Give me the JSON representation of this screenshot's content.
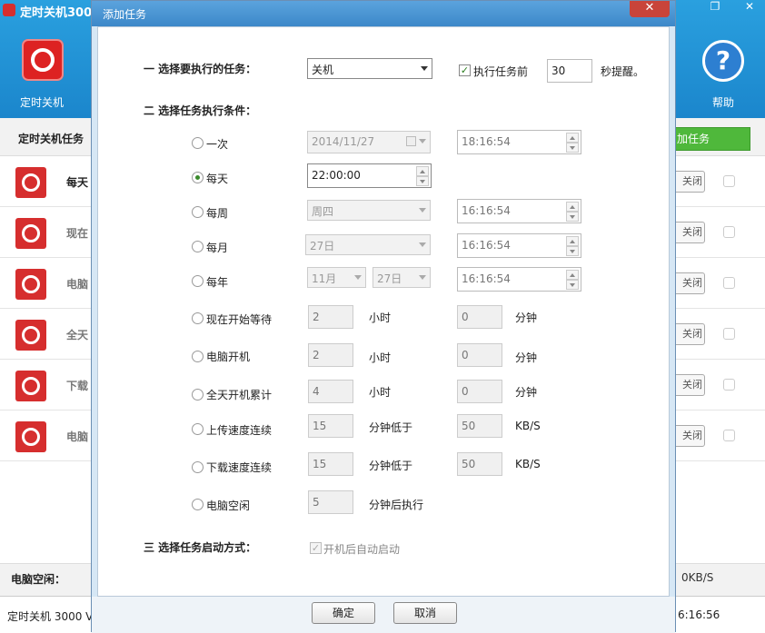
{
  "background": {
    "title": "定时关机3000",
    "logo_label": "定时关机",
    "help_label": "帮助",
    "toolbar_label": "定时关机任务",
    "add_button": "加任务",
    "rows": [
      {
        "text": "每天",
        "button": "关闭"
      },
      {
        "text": "现在",
        "button": "关闭"
      },
      {
        "text": "电脑",
        "button": "关闭"
      },
      {
        "text": "全天",
        "button": "关闭"
      },
      {
        "text": "下载",
        "button": "关闭"
      },
      {
        "text": "电脑",
        "button": "关闭"
      }
    ],
    "idle_label": "电脑空闲：",
    "speed": "0KB/S",
    "version": "定时关机 3000 V",
    "time": "6:16:56",
    "restore_icon": "❐",
    "close_icon": "✕"
  },
  "dialog": {
    "title": "添加任务",
    "close_icon": "✕",
    "section1": "一 选择要执行的任务：",
    "task_select": "关机",
    "remind_checked": true,
    "remind_label": "执行任务前",
    "remind_value": "30",
    "remind_unit": "秒提醒。",
    "section2": "二 选择任务执行条件：",
    "conditions": {
      "once": {
        "label": "一次",
        "date": "2014/11/27",
        "time": "18:16:54"
      },
      "daily": {
        "label": "每天",
        "time": "22:00:00"
      },
      "weekly": {
        "label": "每周",
        "weekday": "周四",
        "time": "16:16:54"
      },
      "monthly": {
        "label": "每月",
        "day": "27日",
        "time": "16:16:54"
      },
      "yearly": {
        "label": "每年",
        "month": "11月",
        "day": "27日",
        "time": "16:16:54"
      },
      "wait": {
        "label": "现在开始等待",
        "hours": "2",
        "unit1": "小时",
        "minutes": "0",
        "unit2": "分钟"
      },
      "boot": {
        "label": "电脑开机",
        "hours": "2",
        "unit1": "小时",
        "minutes": "0",
        "unit2": "分钟"
      },
      "uptime": {
        "label": "全天开机累计",
        "hours": "4",
        "unit1": "小时",
        "minutes": "0",
        "unit2": "分钟"
      },
      "upload": {
        "label": "上传速度连续",
        "minutes": "15",
        "unit1": "分钟低于",
        "speed": "50",
        "unit2": "KB/S"
      },
      "download": {
        "label": "下载速度连续",
        "minutes": "15",
        "unit1": "分钟低于",
        "speed": "50",
        "unit2": "KB/S"
      },
      "idle": {
        "label": "电脑空闲",
        "minutes": "5",
        "unit1": "分钟后执行"
      }
    },
    "selected_condition": "daily",
    "section3": "三 选择任务启动方式：",
    "autostart_label": "开机后自动启动",
    "autostart_checked": true,
    "ok_button": "确定",
    "cancel_button": "取消"
  },
  "colors": {
    "accent_blue": "#2aa0df",
    "brand_red": "#d62e2e",
    "add_green": "#4fb83b"
  }
}
